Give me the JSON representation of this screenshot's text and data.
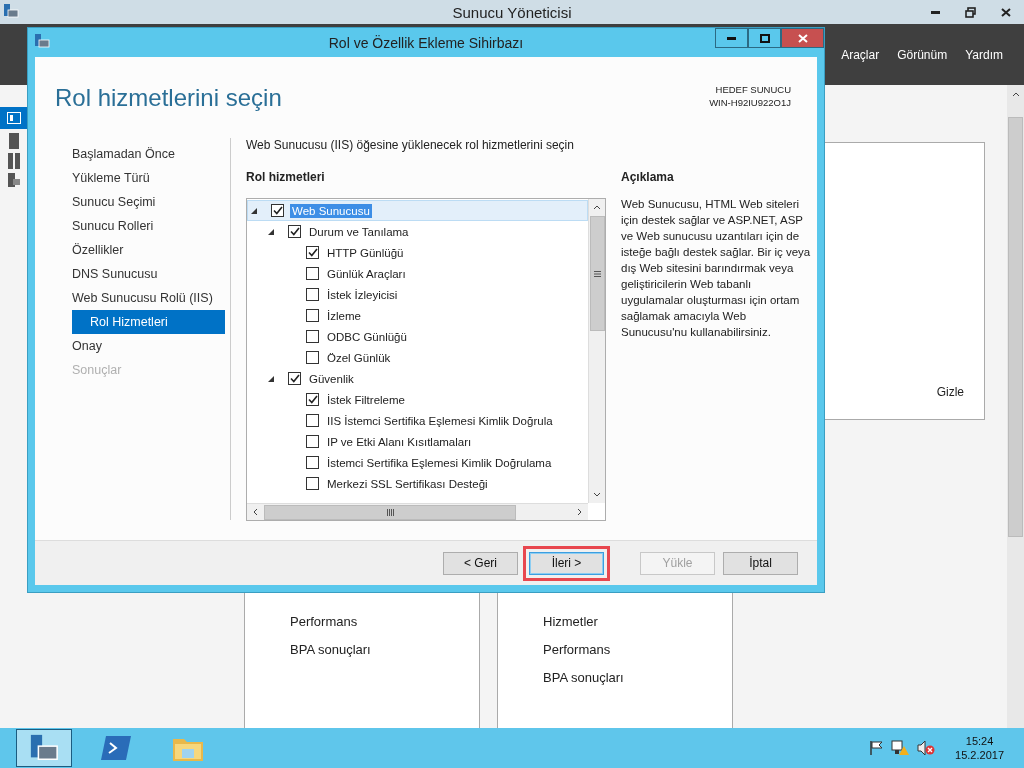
{
  "window": {
    "title": "Sunucu Yöneticisi"
  },
  "menu": [
    "Araçlar",
    "Görünüm",
    "Yardım"
  ],
  "dashboard": {
    "hide_label": "Gizle",
    "tiles": [
      {
        "items": [
          "Performans",
          "BPA sonuçları"
        ]
      },
      {
        "items": [
          "Hizmetler",
          "Performans",
          "BPA sonuçları"
        ]
      }
    ]
  },
  "wizard": {
    "title": "Rol ve Özellik Ekleme Sihirbazı",
    "heading": "Rol hizmetlerini seçin",
    "target_label": "HEDEF SUNUCU",
    "target_server": "WIN-H92IU922O1J",
    "steps": [
      {
        "label": "Başlamadan Önce",
        "selected": false,
        "disabled": false
      },
      {
        "label": "Yükleme Türü",
        "selected": false,
        "disabled": false
      },
      {
        "label": "Sunucu Seçimi",
        "selected": false,
        "disabled": false
      },
      {
        "label": "Sunucu Rolleri",
        "selected": false,
        "disabled": false
      },
      {
        "label": "Özellikler",
        "selected": false,
        "disabled": false
      },
      {
        "label": "DNS Sunucusu",
        "selected": false,
        "disabled": false
      },
      {
        "label": "Web Sunucusu Rolü (IIS)",
        "selected": false,
        "disabled": false,
        "children": [
          {
            "label": "Rol Hizmetleri",
            "selected": true,
            "disabled": false
          }
        ]
      },
      {
        "label": "Onay",
        "selected": false,
        "disabled": false
      },
      {
        "label": "Sonuçlar",
        "selected": false,
        "disabled": true
      }
    ],
    "instruction": "Web Sunucusu (IIS) öğesine yüklenecek rol hizmetlerini seçin",
    "tree_heading": "Rol hizmetleri",
    "tree": [
      {
        "label": "Web Sunucusu",
        "checked": true,
        "selected": true,
        "expanded": true,
        "children": [
          {
            "label": "Durum ve Tanılama",
            "checked": true,
            "selected": false,
            "expanded": true,
            "children": [
              {
                "label": "HTTP Günlüğü",
                "checked": true,
                "selected": false
              },
              {
                "label": "Günlük Araçları",
                "checked": false,
                "selected": false
              },
              {
                "label": "İstek İzleyicisi",
                "checked": false,
                "selected": false
              },
              {
                "label": "İzleme",
                "checked": false,
                "selected": false
              },
              {
                "label": "ODBC Günlüğü",
                "checked": false,
                "selected": false
              },
              {
                "label": "Özel Günlük",
                "checked": false,
                "selected": false
              }
            ]
          },
          {
            "label": "Güvenlik",
            "checked": true,
            "selected": false,
            "expanded": true,
            "children": [
              {
                "label": "İstek Filtreleme",
                "checked": true,
                "selected": false
              },
              {
                "label": "IIS İstemci Sertifika Eşlemesi Kimlik Doğrula",
                "checked": false,
                "selected": false
              },
              {
                "label": "IP ve Etki Alanı Kısıtlamaları",
                "checked": false,
                "selected": false
              },
              {
                "label": "İstemci Sertifika Eşlemesi Kimlik Doğrulama",
                "checked": false,
                "selected": false
              },
              {
                "label": "Merkezi SSL Sertifikası Desteği",
                "checked": false,
                "selected": false
              }
            ]
          }
        ]
      }
    ],
    "description_heading": "Açıklama",
    "description": "Web Sunucusu, HTML Web siteleri için destek sağlar ve ASP.NET, ASP ve Web sunucusu uzantıları için de isteğe bağlı destek sağlar. Bir iç veya dış Web sitesini barındırmak veya geliştiricilerin Web tabanlı uygulamalar oluşturması için ortam sağlamak amacıyla Web Sunucusu'nu kullanabilirsiniz.",
    "buttons": [
      {
        "label": "< Geri",
        "disabled": false,
        "highlighted": false
      },
      {
        "label": "İleri >",
        "disabled": false,
        "highlighted": true
      },
      {
        "label": "Yükle",
        "disabled": true,
        "highlighted": false
      },
      {
        "label": "İptal",
        "disabled": false,
        "highlighted": false
      }
    ]
  },
  "taskbar": {
    "time": "15:24",
    "date": "15.2.2017"
  }
}
